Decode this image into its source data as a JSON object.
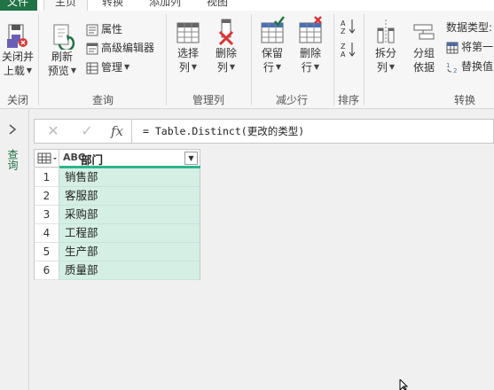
{
  "menu_tabs": {
    "file": "文件",
    "home": "主页",
    "transform": "转换",
    "add_column": "添加列",
    "view": "视图"
  },
  "ribbon": {
    "close_group": {
      "label": "关闭",
      "close_load_line1": "关闭并",
      "close_load_line2": "上载"
    },
    "query_group": {
      "label": "查询",
      "refresh_line1": "刷新",
      "refresh_line2": "预览",
      "properties": "属性",
      "advanced_editor": "高级编辑器",
      "manage": "管理"
    },
    "manage_columns_group": {
      "label": "管理列",
      "choose_columns_line1": "选择",
      "choose_columns_line2": "列",
      "remove_columns_line1": "删除",
      "remove_columns_line2": "列"
    },
    "reduce_rows_group": {
      "label": "减少行",
      "keep_rows_line1": "保留",
      "keep_rows_line2": "行",
      "remove_rows_line1": "删除",
      "remove_rows_line2": "行"
    },
    "sort_group": {
      "label": "排序"
    },
    "transform_group": {
      "label": "转换",
      "split_column_line1": "拆分",
      "split_column_line2": "列",
      "group_by_line1": "分组",
      "group_by_line2": "依据",
      "data_type": "数据类型:",
      "use_first_row": "将第一",
      "replace_values": "替换值"
    }
  },
  "query_pane": {
    "label": "查询"
  },
  "formula_bar": {
    "cancel_glyph": "✕",
    "confirm_glyph": "✓",
    "fx_glyph": "fx",
    "formula": "= Table.Distinct(更改的类型)"
  },
  "table": {
    "column": {
      "type_glyph": "ABC",
      "name": "部门",
      "filter_glyph": "▼"
    },
    "rows": [
      {
        "num": "1",
        "value": "销售部"
      },
      {
        "num": "2",
        "value": "客服部"
      },
      {
        "num": "3",
        "value": "采购部"
      },
      {
        "num": "4",
        "value": "工程部"
      },
      {
        "num": "5",
        "value": "生产部"
      },
      {
        "num": "6",
        "value": "质量部"
      }
    ]
  },
  "colors": {
    "accent": "#217346",
    "cell_fill": "#d5efe4",
    "quality_bar": "#2bb58e"
  }
}
